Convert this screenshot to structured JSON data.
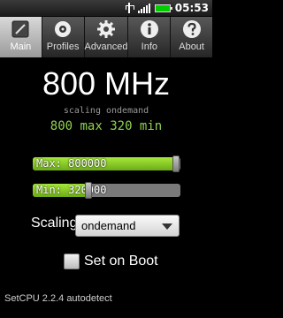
{
  "status_bar": {
    "time": "05:53",
    "battery_color": "#00cc00"
  },
  "tabs": [
    {
      "label": "Main",
      "icon": "main-icon",
      "active": true
    },
    {
      "label": "Profiles",
      "icon": "profiles-icon",
      "active": false
    },
    {
      "label": "Advanced",
      "icon": "gear-icon",
      "active": false
    },
    {
      "label": "Info",
      "icon": "info-icon",
      "active": false
    },
    {
      "label": "About",
      "icon": "help-icon",
      "active": false
    }
  ],
  "main": {
    "current_frequency": "800 MHz",
    "governor_line": "scaling ondemand",
    "range_line": "800 max 320 min",
    "range_color": "#8fd14f",
    "max_slider": {
      "label": "Max: 800000",
      "level": 0.97
    },
    "min_slider": {
      "label": "Min: 320000",
      "level": 0.38
    },
    "scaling_label": "Scaling",
    "scaling_value": "ondemand",
    "set_on_boot_label": "Set on Boot",
    "set_on_boot_checked": false
  },
  "footer": {
    "version_text": "SetCPU 2.2.4 autodetect"
  }
}
